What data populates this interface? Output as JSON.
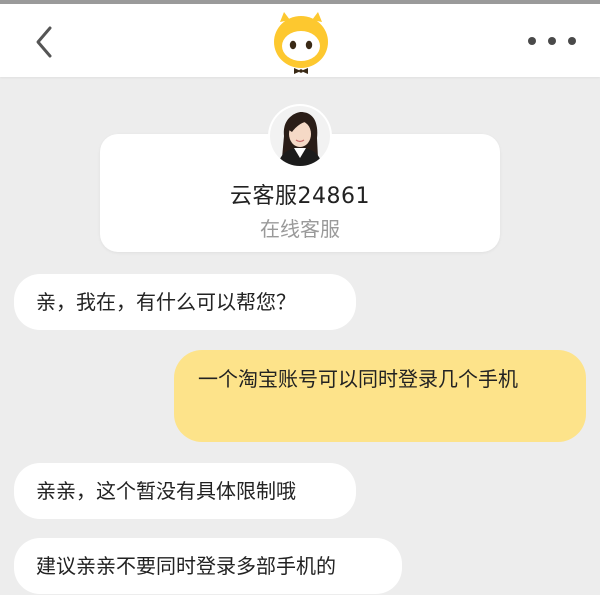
{
  "header": {
    "back_icon": "chevron-left-icon",
    "logo_icon": "mascot-logo-icon",
    "more_icon": "more-dots-icon"
  },
  "agent": {
    "name": "云客服24861",
    "status": "在线客服"
  },
  "messages": [
    {
      "side": "left",
      "text": "亲，我在，有什么可以帮您？"
    },
    {
      "side": "right",
      "text": "一个淘宝账号可以同时登录几个手机"
    },
    {
      "side": "left",
      "text": "亲亲，这个暂没有具体限制哦"
    },
    {
      "side": "left",
      "text": "建议亲亲不要同时登录多部手机的"
    }
  ],
  "colors": {
    "accent": "#fdc82f",
    "user_bubble": "#fde38a",
    "agent_bubble": "#ffffff",
    "background": "#ededed"
  }
}
